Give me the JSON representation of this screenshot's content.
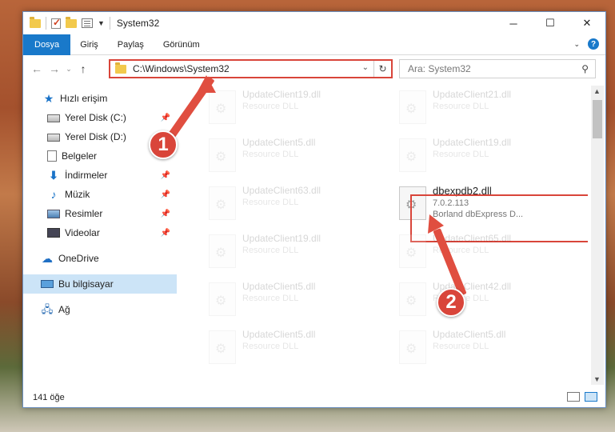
{
  "window": {
    "title": "System32"
  },
  "ribbon": {
    "tabs": [
      "Dosya",
      "Giriş",
      "Paylaş",
      "Görünüm"
    ]
  },
  "navbar": {
    "address": "C:\\Windows\\System32",
    "search_placeholder": "Ara: System32"
  },
  "sidebar": {
    "items": [
      {
        "label": "Hızlı erişim",
        "icon": "star-icon"
      },
      {
        "label": "Yerel Disk (C:)",
        "icon": "drive-icon",
        "pinned": true
      },
      {
        "label": "Yerel Disk (D:)",
        "icon": "drive-icon"
      },
      {
        "label": "Belgeler",
        "icon": "documents-icon"
      },
      {
        "label": "İndirmeler",
        "icon": "download-icon",
        "pinned": true
      },
      {
        "label": "Müzik",
        "icon": "music-icon",
        "pinned": true
      },
      {
        "label": "Resimler",
        "icon": "pictures-icon",
        "pinned": true
      },
      {
        "label": "Videolar",
        "icon": "videos-icon",
        "pinned": true
      },
      {
        "label": "OneDrive",
        "icon": "cloud-icon"
      },
      {
        "label": "Bu bilgisayar",
        "icon": "computer-icon",
        "selected": true
      },
      {
        "label": "Ağ",
        "icon": "network-icon"
      }
    ]
  },
  "files": {
    "left": [
      {
        "name": "UpdateClient19.dll",
        "type": "Resource DLL"
      },
      {
        "name": "UpdateClient5.dll",
        "type": "Resource DLL"
      },
      {
        "name": "UpdateClient63.dll",
        "type": "Resource DLL"
      },
      {
        "name": "UpdateClient19.dll",
        "type": "Resource DLL"
      },
      {
        "name": "UpdateClient5.dll",
        "type": "Resource DLL"
      },
      {
        "name": "UpdateClient5.dll",
        "type": "Resource DLL"
      }
    ],
    "right": [
      {
        "name": "UpdateClient21.dll",
        "type": "Resource DLL"
      },
      {
        "name": "UpdateClient19.dll",
        "type": "Resource DLL"
      },
      {
        "name": "UpdateClient65.dll",
        "type": "Resource DLL"
      },
      {
        "name": "UpdateClient42.dll",
        "type": "Resource DLL"
      },
      {
        "name": "UpdateClient5.dll",
        "type": "Resource DLL"
      }
    ],
    "highlighted": {
      "name": "dbexpdb2.dll",
      "version": "7.0.2.113",
      "description": "Borland dbExpress D..."
    }
  },
  "status": {
    "count": "141 öğe"
  },
  "callouts": {
    "one": "1",
    "two": "2"
  },
  "colors": {
    "accent": "#1979ca",
    "highlight": "#d9453a"
  }
}
